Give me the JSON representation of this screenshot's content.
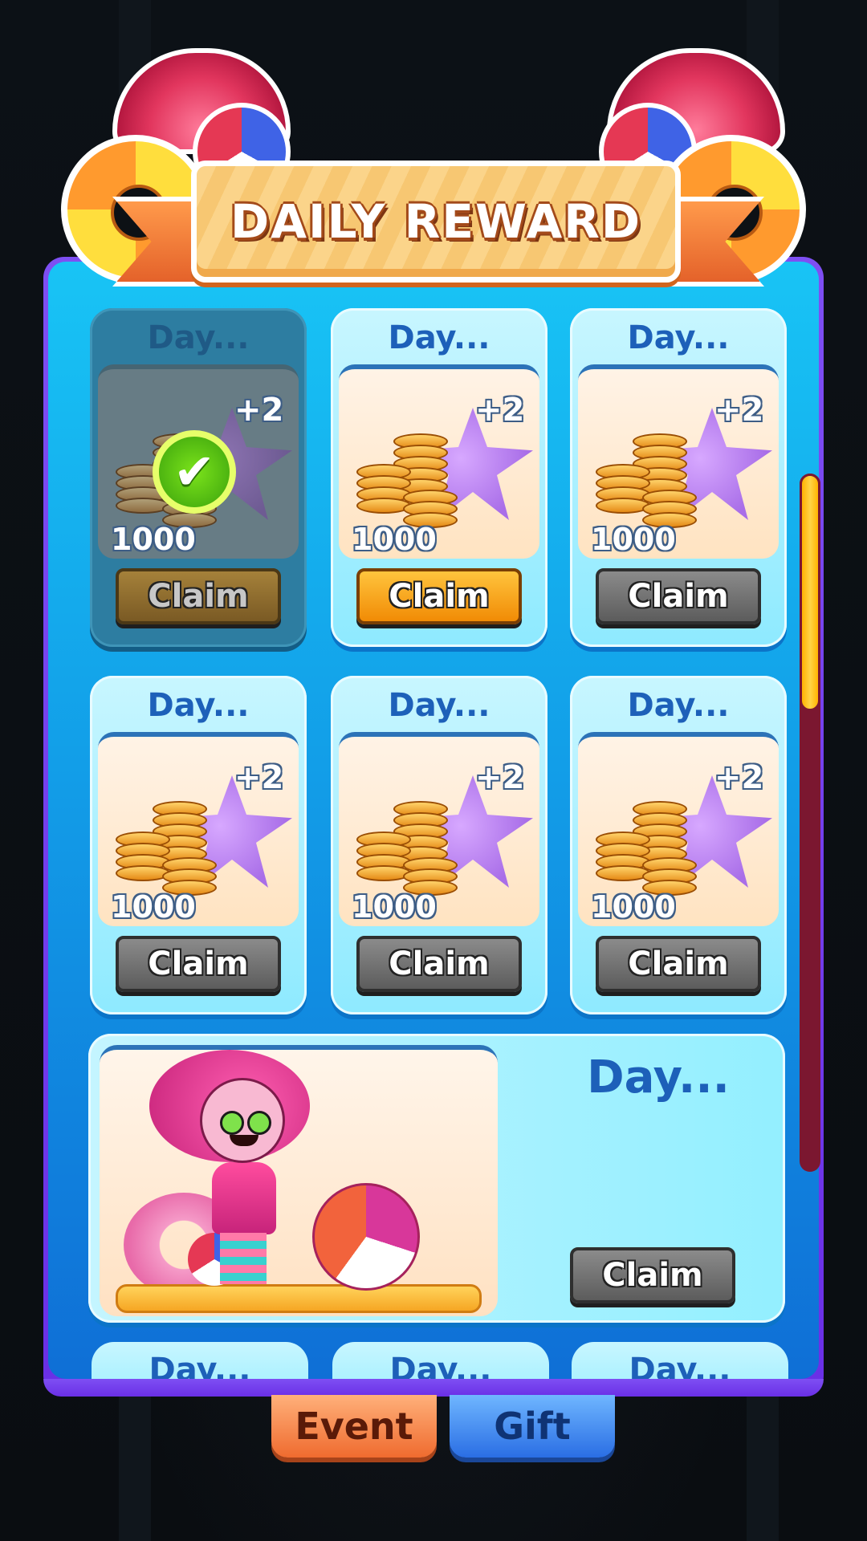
{
  "header": {
    "title": "DAILY REWARD"
  },
  "days": [
    {
      "title": "Day...",
      "bonus": "+2",
      "amount": "1000",
      "claim_label": "Claim",
      "state": "claimed"
    },
    {
      "title": "Day...",
      "bonus": "+2",
      "amount": "1000",
      "claim_label": "Claim",
      "state": "available"
    },
    {
      "title": "Day...",
      "bonus": "+2",
      "amount": "1000",
      "claim_label": "Claim",
      "state": "locked"
    },
    {
      "title": "Day...",
      "bonus": "+2",
      "amount": "1000",
      "claim_label": "Claim",
      "state": "locked"
    },
    {
      "title": "Day...",
      "bonus": "+2",
      "amount": "1000",
      "claim_label": "Claim",
      "state": "locked"
    },
    {
      "title": "Day...",
      "bonus": "+2",
      "amount": "1000",
      "claim_label": "Claim",
      "state": "locked"
    }
  ],
  "big_day": {
    "title": "Day...",
    "claim_label": "Claim",
    "state": "locked"
  },
  "peek_days": [
    {
      "title": "Day..."
    },
    {
      "title": "Day..."
    },
    {
      "title": "Day..."
    }
  ],
  "tabs": {
    "event": "Event",
    "gift": "Gift",
    "active": "event"
  },
  "scroll": {
    "position_fraction": 0.0,
    "visible_fraction": 0.34
  },
  "colors": {
    "panel_border": "#6a2fe6",
    "panel_fill": "#129ee8",
    "claim_available": "#f18b05",
    "claim_locked": "#5c5c5c",
    "claimed_check": "#3aa10c",
    "scroll_thumb": "#ffd447"
  },
  "icons": [
    "umbrella-icon",
    "swim-ring-icon",
    "beach-ball-icon",
    "coin-stack-icon",
    "starfish-icon",
    "check-icon"
  ]
}
